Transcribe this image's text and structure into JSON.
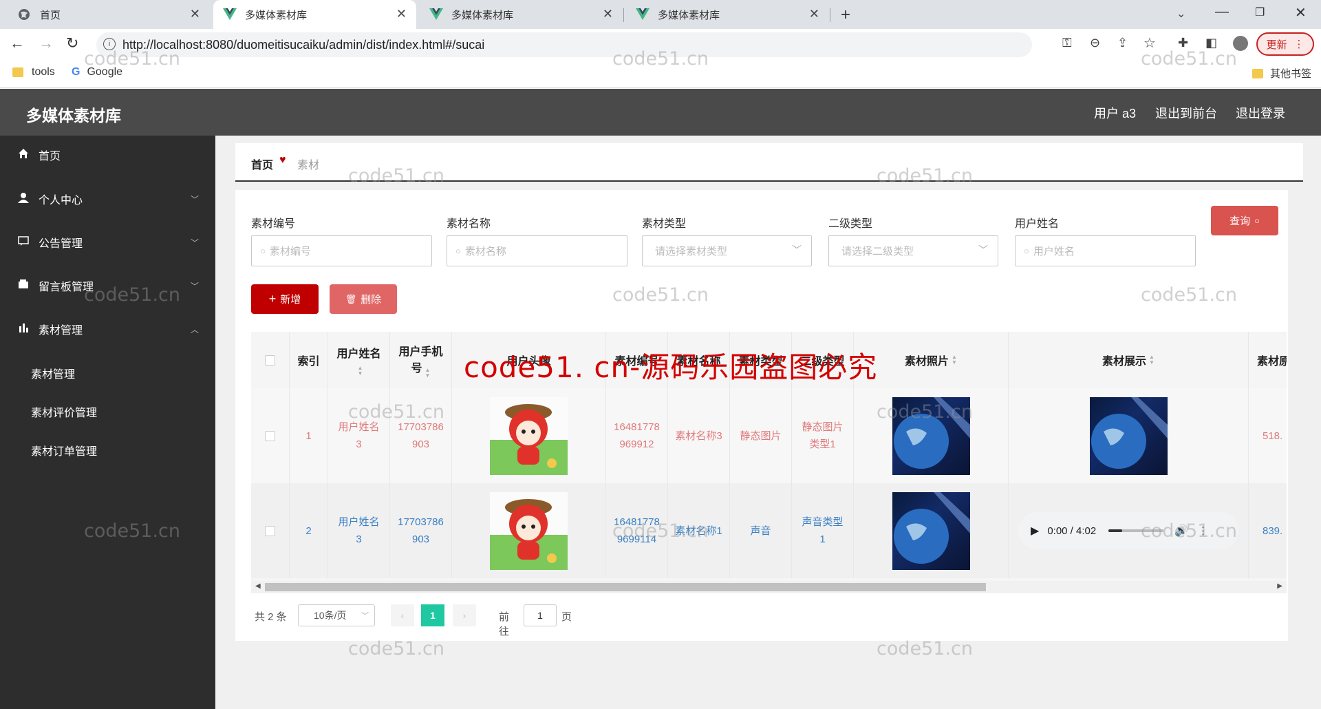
{
  "browser": {
    "tabs": [
      {
        "title": "首页",
        "active": false
      },
      {
        "title": "多媒体素材库",
        "active": true
      },
      {
        "title": "多媒体素材库",
        "active": false
      },
      {
        "title": "多媒体素材库",
        "active": false
      }
    ],
    "url": "http://localhost:8080/duomeitisucaiku/admin/dist/index.html#/sucai",
    "update_button": "更新",
    "bookmarks": [
      "tools",
      "Google"
    ],
    "other_bookmarks": "其他书签"
  },
  "header": {
    "title": "多媒体素材库",
    "user": "用户 a3",
    "back_to_front": "退出到前台",
    "logout": "退出登录"
  },
  "sidebar": {
    "items": [
      {
        "label": "首页",
        "icon": "home-icon"
      },
      {
        "label": "个人中心",
        "icon": "user-icon"
      },
      {
        "label": "公告管理",
        "icon": "message-icon"
      },
      {
        "label": "留言板管理",
        "icon": "wallet-icon"
      },
      {
        "label": "素材管理",
        "icon": "chart-icon"
      }
    ],
    "sub_items": [
      "素材管理",
      "素材评价管理",
      "素材订单管理"
    ]
  },
  "breadcrumb": {
    "home": "首页",
    "current": "素材"
  },
  "filters": [
    {
      "label": "素材编号",
      "placeholder": "素材编号"
    },
    {
      "label": "素材名称",
      "placeholder": "素材名称"
    },
    {
      "label": "素材类型",
      "placeholder": "请选择素材类型"
    },
    {
      "label": "二级类型",
      "placeholder": "请选择二级类型"
    },
    {
      "label": "用户姓名",
      "placeholder": "用户姓名"
    }
  ],
  "buttons": {
    "query": "查询",
    "add": "新增",
    "delete": "删除"
  },
  "table": {
    "headers": [
      "索引",
      "用户姓名",
      "用户手机号",
      "用户头像",
      "素材编号",
      "素材名称",
      "素材类型",
      "二级类型",
      "素材照片",
      "素材展示",
      "素材原"
    ],
    "rows": [
      {
        "index": "1",
        "user_name": "用户姓名3",
        "phone": "17703786903",
        "code": "16481778969912",
        "name": "素材名称3",
        "type": "静态图片",
        "subtype": "静态图片类型1",
        "display": "image",
        "price": "518."
      },
      {
        "index": "2",
        "user_name": "用户姓名3",
        "phone": "17703786903",
        "code": "164817789699114",
        "name": "素材名称1",
        "type": "声音",
        "subtype": "声音类型1",
        "display": "audio",
        "audio_time": "0:00 / 4:02",
        "price": "839."
      }
    ]
  },
  "pagination": {
    "total": "共 2 条",
    "page_size": "10条/页",
    "current_page": "1",
    "goto_prefix": "前往",
    "goto_value": "1",
    "goto_suffix": "页"
  },
  "overlay_text": "code51. cn-源码乐园盗图必究",
  "watermark": "code51.cn",
  "colors": {
    "header": "#4a4a4a",
    "sidebar": "#2d2d2d",
    "accent_red": "#c00000",
    "delete_btn": "#e06666",
    "query_btn": "#d9534f",
    "page_active": "#1fc8a0",
    "row_link_red": "#e07a7a",
    "row_link_blue": "#3a7fc4"
  }
}
